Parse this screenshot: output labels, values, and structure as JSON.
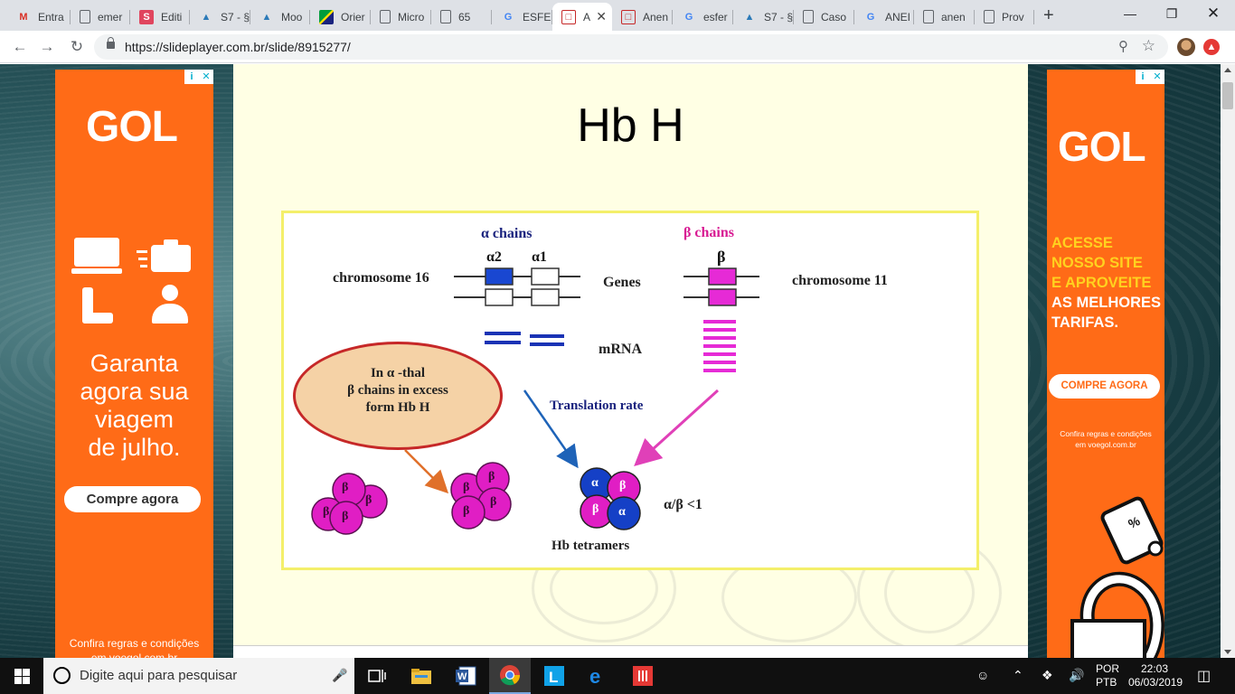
{
  "browser": {
    "tabs": [
      {
        "label": "Entra",
        "icon": "gmail-icon"
      },
      {
        "label": "emer",
        "icon": "document-icon"
      },
      {
        "label": "Editi",
        "icon": "s-icon"
      },
      {
        "label": "S7 - §",
        "icon": "moodle-icon"
      },
      {
        "label": "Moo",
        "icon": "moodle-icon"
      },
      {
        "label": "Orier",
        "icon": "flag-icon"
      },
      {
        "label": "Micro",
        "icon": "document-icon"
      },
      {
        "label": "65",
        "icon": "document-icon"
      },
      {
        "label": "ESFER",
        "icon": "google-icon"
      },
      {
        "label": "A",
        "icon": "slideplayer-icon",
        "active": true
      },
      {
        "label": "Anen",
        "icon": "slideplayer-icon"
      },
      {
        "label": "esfer",
        "icon": "google-icon"
      },
      {
        "label": "S7 - §",
        "icon": "moodle-icon"
      },
      {
        "label": "Caso",
        "icon": "document-icon"
      },
      {
        "label": "ANEI",
        "icon": "google-icon"
      },
      {
        "label": "anen",
        "icon": "document-icon"
      },
      {
        "label": "Prov",
        "icon": "document-icon"
      }
    ],
    "url": "https://slideplayer.com.br/slide/8915277/"
  },
  "ads": {
    "left": {
      "brand": "GOL",
      "tagline": [
        "Garanta",
        "agora sua",
        "viagem",
        "de julho."
      ],
      "button": "Compre agora",
      "fine_print": [
        "Confira regras e condições",
        "em voegol.com.br"
      ]
    },
    "right": {
      "brand": "GOL",
      "headline_yellow": [
        "ACESSE",
        "NOSSO SITE",
        "E APROVEITE"
      ],
      "headline_white": [
        "AS MELHORES",
        "TARIFAS."
      ],
      "button": "COMPRE AGORA",
      "fine_print": [
        "Confira regras e condições",
        "em voegol.com.br"
      ]
    }
  },
  "slide": {
    "title": "Hb H",
    "figure": {
      "alpha_chains": "α  chains",
      "beta_chains": "β  chains",
      "alpha2": "α2",
      "alpha1": "α1",
      "beta": "β",
      "chromosome16": "chromosome 16",
      "genes": "Genes",
      "chromosome11": "chromosome 11",
      "mrna": "mRNA",
      "bubble_lines": [
        "In α -thal",
        "β chains in excess",
        "form  Hb H"
      ],
      "translation_rate": "Translation rate",
      "ratio": "α/β <1",
      "tetramers": "Hb tetramers",
      "beta_symbol": "β",
      "alpha_symbol": "α"
    }
  },
  "taskbar": {
    "search_placeholder": "Digite aqui para pesquisar",
    "lang_top": "POR",
    "lang_bottom": "PTB",
    "time": "22:03",
    "date": "06/03/2019"
  }
}
